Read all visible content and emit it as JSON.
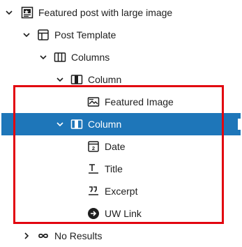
{
  "colors": {
    "selected_bg": "#1e76b9",
    "highlight_border": "#e2050f",
    "text": "#1e1e1e"
  },
  "tree": {
    "featured_post": {
      "label": "Featured post with large image",
      "icon": "post-featured-icon"
    },
    "post_template": {
      "label": "Post Template",
      "icon": "layout-icon"
    },
    "columns": {
      "label": "Columns",
      "icon": "columns-icon"
    },
    "column_1": {
      "label": "Column",
      "icon": "column-icon"
    },
    "featured_image": {
      "label": "Featured Image",
      "icon": "image-icon"
    },
    "column_2": {
      "label": "Column",
      "icon": "column-icon",
      "selected": true
    },
    "date": {
      "label": "Date",
      "icon": "calendar-icon",
      "icon_text": "2"
    },
    "title": {
      "label": "Title",
      "icon": "title-icon"
    },
    "excerpt": {
      "label": "Excerpt",
      "icon": "quote-icon"
    },
    "uw_link": {
      "label": "UW Link",
      "icon": "arrow-circle-icon"
    },
    "no_results": {
      "label": "No Results",
      "icon": "infinity-icon"
    }
  }
}
